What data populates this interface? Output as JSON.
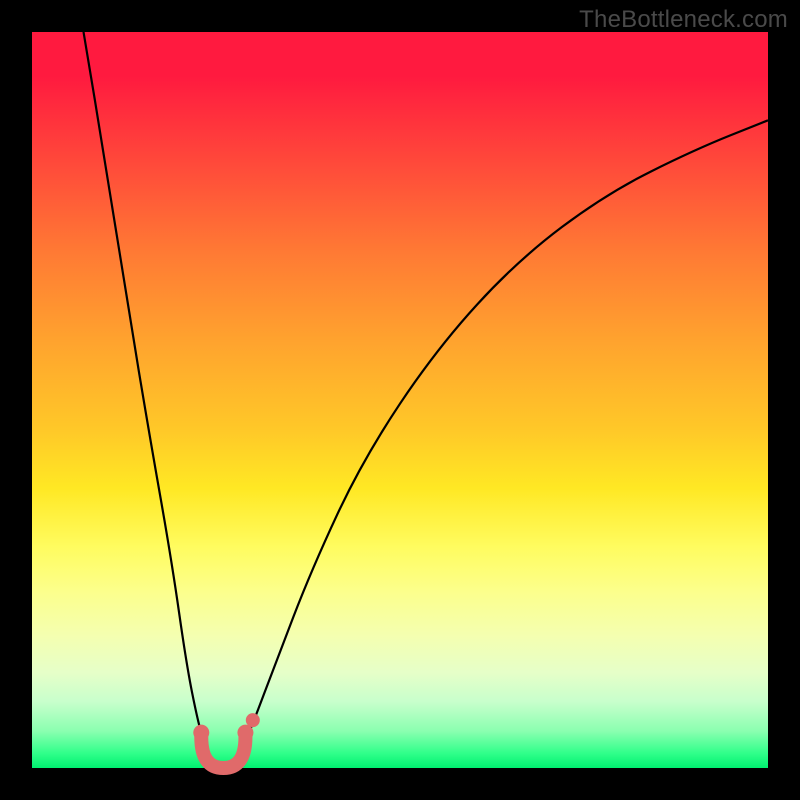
{
  "watermark": "TheBottleneck.com",
  "palette": {
    "background_frame": "#000000",
    "gradient_top": "#ff1a3f",
    "gradient_bottom": "#00f070",
    "curve_stroke": "#000000",
    "marker_color": "#e06a6a"
  },
  "chart_data": {
    "type": "line",
    "title": "",
    "xlabel": "",
    "ylabel": "",
    "xlim": [
      0,
      100
    ],
    "ylim": [
      0,
      100
    ],
    "grid": false,
    "legend": false,
    "background": "rainbow-vertical-gradient",
    "series": [
      {
        "name": "left-curve",
        "x": [
          7.0,
          10,
          13,
          16,
          19,
          21,
          22.5,
          23.5,
          24.0,
          24.5
        ],
        "y": [
          100,
          82,
          63,
          45,
          28,
          14,
          6.5,
          3.0,
          1.5,
          0.5
        ]
      },
      {
        "name": "right-curve",
        "x": [
          27.5,
          28.5,
          30,
          33,
          38,
          45,
          55,
          66,
          78,
          90,
          100
        ],
        "y": [
          0.5,
          2.5,
          6,
          14,
          27,
          42,
          57,
          69,
          78,
          84,
          88
        ]
      }
    ],
    "annotations": [
      {
        "name": "u-shaped-marker",
        "type": "arc",
        "description": "salmon/coral U-shaped cluster of dots at the valley between the two curves",
        "center_x": 26.0,
        "center_y": 3.0,
        "approx_radius": 3.0,
        "color": "#e06a6a"
      },
      {
        "name": "offset-marker-dot",
        "type": "dot",
        "x": 30.0,
        "y": 6.5,
        "color": "#e06a6a"
      }
    ]
  }
}
